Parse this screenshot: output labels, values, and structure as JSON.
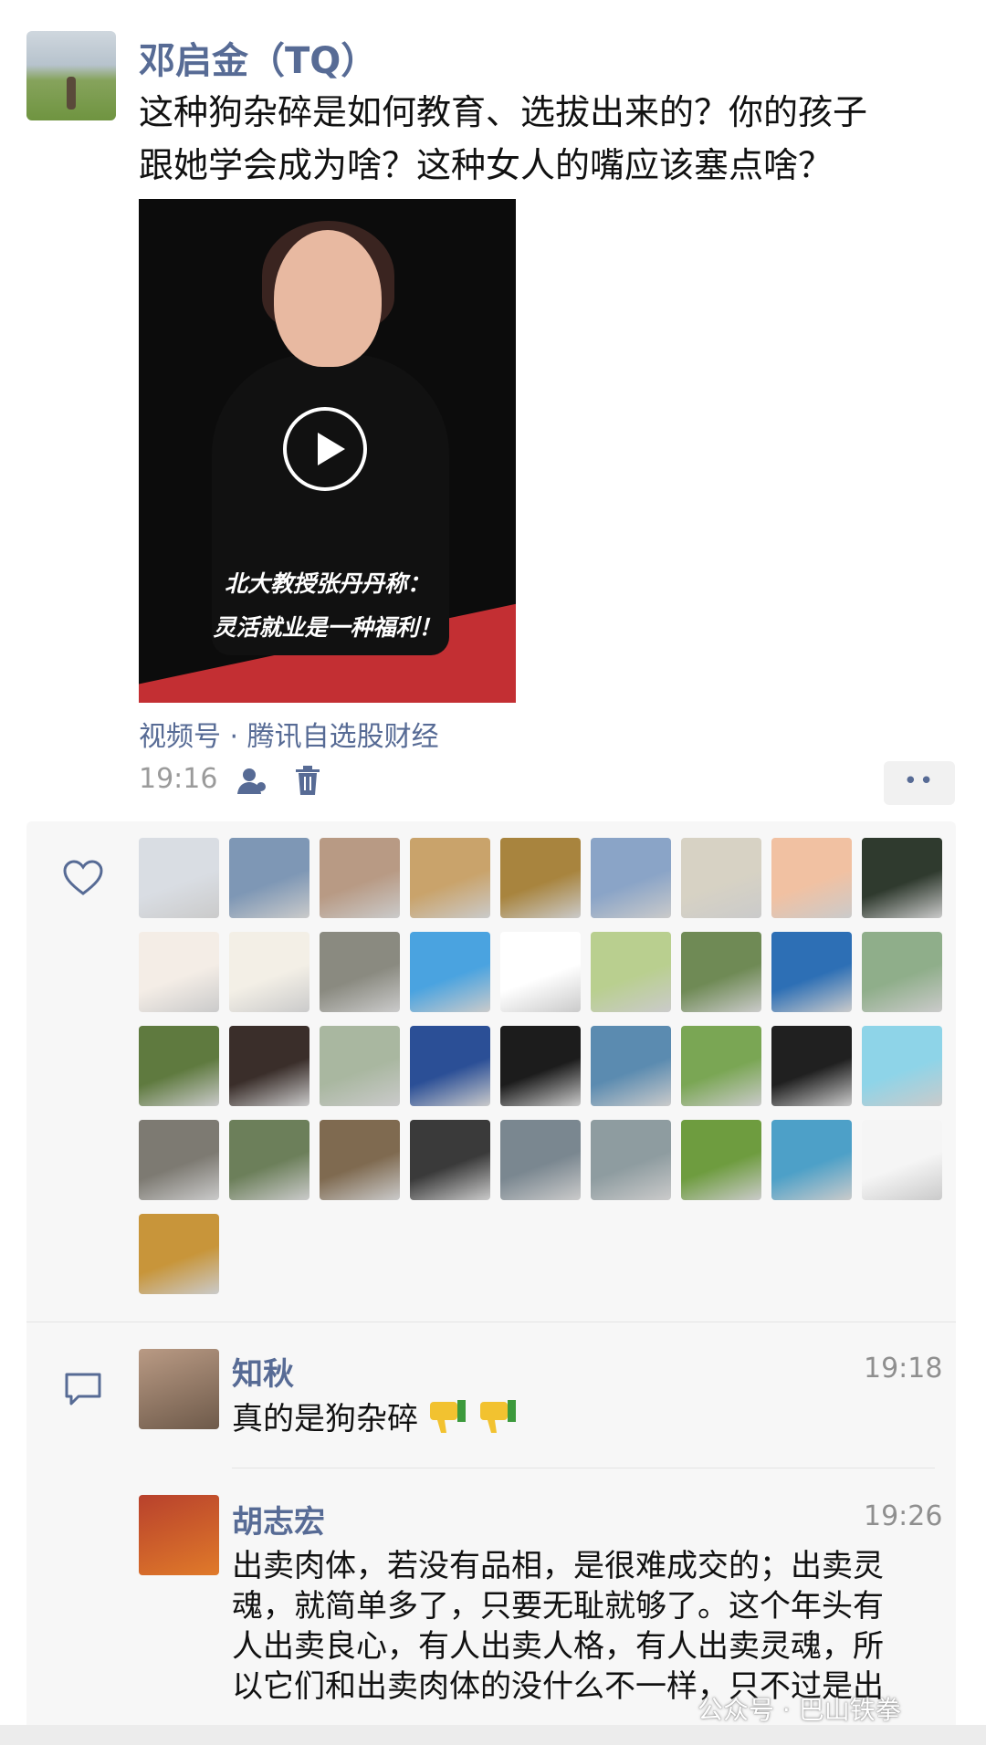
{
  "post": {
    "author": "邓启金（TQ）",
    "text_line1": "这种狗杂碎是如何教育、选拔出来的？你的孩子",
    "text_line2": "跟她学会成为啥？这种女人的嘴应该塞点啥？",
    "video": {
      "caption_line1": "北大教授张丹丹称：",
      "caption_line2": "灵活就业是一种福利！"
    },
    "source": "视频号 · 腾讯自选股财经",
    "time": "19:16",
    "more_label": "••"
  },
  "likes": {
    "avatar_colors": [
      "#d9dde3",
      "#7e97b5",
      "#b89a84",
      "#c9a36b",
      "#a8843e",
      "#8aa4c7",
      "#d7d2c4",
      "#f1c1a2",
      "#2f3a2e",
      "#f4ede6",
      "#f3efe6",
      "#8a8a80",
      "#4aa3e0",
      "#ffffff",
      "#b9cf8f",
      "#6f8a55",
      "#2d6fb5",
      "#8fae8a",
      "#5f7a3f",
      "#3a2e2a",
      "#a9b7a0",
      "#2b4f96",
      "#1c1c1c",
      "#5b8bb0",
      "#7aa654",
      "#202020",
      "#8ed4e8",
      "#7d7a72",
      "#6c7f5a",
      "#7f6a50",
      "#3a3a3a",
      "#7a8790",
      "#8e9ca0",
      "#6e9c3f",
      "#4da0c8",
      "#f5f5f5",
      "#c8953a"
    ],
    "heart_color": "#576b95"
  },
  "comments": [
    {
      "name": "知秋",
      "time": "19:18",
      "text": "真的是狗杂碎",
      "avatar_color": "#b99a84"
    },
    {
      "name": "胡志宏",
      "time": "19:26",
      "avatar_color": "#b8412c",
      "lines": [
        "出卖肉体，若没有品相，是很难成交的；出卖灵",
        "魂，就简单多了，只要无耻就够了。这个年头有",
        "人出卖良心，有人出卖人格，有人出卖灵魂，所",
        "以它们和出卖肉体的没什么不一样，只不过是出"
      ]
    }
  ],
  "watermark": "公众号 · 巴山铁拳"
}
